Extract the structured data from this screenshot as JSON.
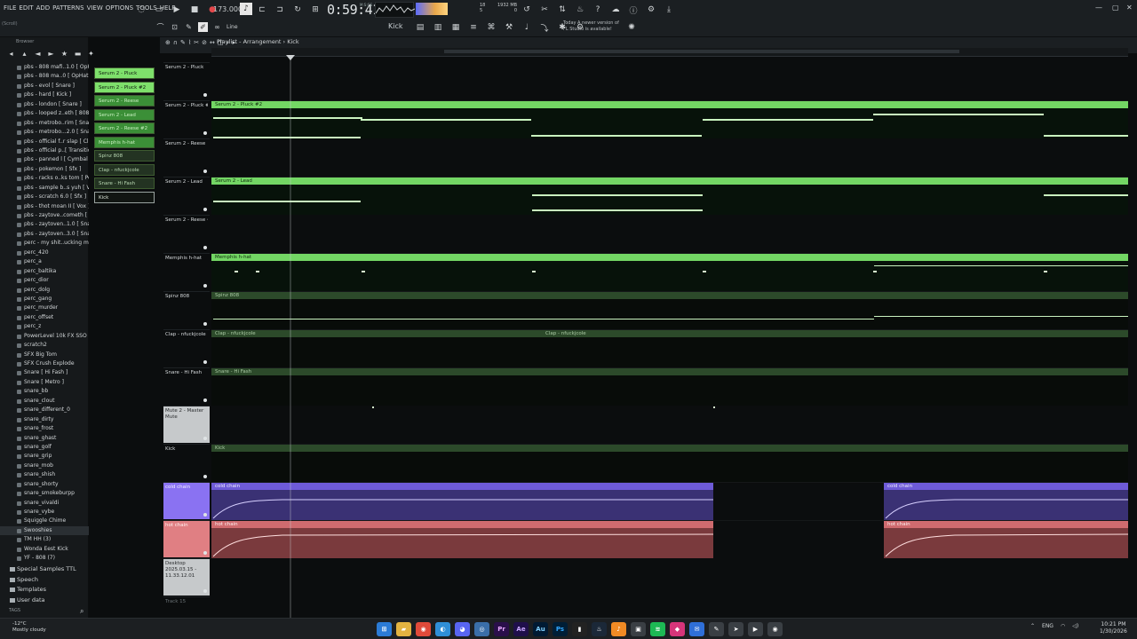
{
  "menu": [
    "FILE",
    "EDIT",
    "ADD",
    "PATTERNS",
    "VIEW",
    "OPTIONS",
    "TOOLS",
    "HELP"
  ],
  "transport": {
    "tempo": "173.000",
    "time": "0:59:41",
    "time_sub": "M:S:CS",
    "cpu": "18",
    "cpu_sub": "5",
    "mem": "1932 MB",
    "mem_sub": "0",
    "news_line1": "Today  A newer version of",
    "news_line2": "FL Studio is available!"
  },
  "toolbar": {
    "line_mode": "Line",
    "pattern": "Kick",
    "search_hint": "(Scroll)"
  },
  "browser": {
    "title": "Browser",
    "items": [
      "pbs - 808 mafi..1.0 [ OpHat ]",
      "pbs - 808 ma..0 [ OpHat ] ★",
      "pbs - evol [ Snare ]",
      "pbs - hard [ Kick ]",
      "pbs - london [ Snare ]",
      "pbs - looped z..eth [ 808 ]_2",
      "pbs - metrobo..rim [ Snare ]",
      "pbs - metrobo...2.0 [ Snare ]",
      "pbs - official f..r slap [ Clap ]",
      "pbs - official p..[ Transition]",
      "pbs - panned l [ Cymbal ]",
      "pbs - pokemon [ Sfx ]",
      "pbs - racks o..ks tom [ Perc ]",
      "pbs - sample b..s yuh [ Vox ]",
      "pbs - scratch 6.0 [ Sfx ]",
      "pbs - thot moan II [ Vox ]",
      "pbs - zaytove..cometh [ 808 ]",
      "pbs - zaytoven..1.0 [ Snare ]",
      "pbs - zaytoven..3.0 [ Snare ]",
      "perc - my shit..ucking musive",
      "perc_420",
      "perc_a",
      "perc_baltika",
      "perc_dior",
      "perc_dolg",
      "perc_gang",
      "perc_murder",
      "perc_offset",
      "perc_z",
      "PowerLevel 10k FX SSO",
      "scratch2",
      "SFX Big Tom",
      "SFX Crush Explode",
      "Snare [ Hi Fash ]",
      "Snare [ Metro ]",
      "snare_bb",
      "snare_clout",
      "snare_different_0",
      "snare_dirty",
      "snare_frost",
      "snare_ghast",
      "snare_golf",
      "snare_grip",
      "snare_mob",
      "snare_shish",
      "snare_shorty",
      "snare_smokeburpp",
      "snare_vivaldi",
      "snare_vybe",
      "Squiggle Chime",
      "Swooshies",
      "TM HH (3)",
      "Wonda Eest Kick",
      "YF - 808 (7)"
    ],
    "selected_index": 50,
    "folders": [
      "Special Samples TTL",
      "Speech",
      "Templates",
      "User data"
    ],
    "tags_label": "TAGS"
  },
  "rack": [
    {
      "label": "Serum 2 - Pluck",
      "style": "bright"
    },
    {
      "label": "Serum 2 - Pluck #2",
      "style": "bright"
    },
    {
      "label": "Serum 2 - Reese",
      "style": "mid"
    },
    {
      "label": "Serum 2 - Lead",
      "style": "mid"
    },
    {
      "label": "Serum 2 - Reese #2",
      "style": "mid"
    },
    {
      "label": "Memphis h-hat",
      "style": "mid"
    },
    {
      "label": "Spinz 808",
      "style": "dark"
    },
    {
      "label": "Clap - nfuckjcole",
      "style": "dark"
    },
    {
      "label": "Snare - Hi Fash",
      "style": "dark"
    },
    {
      "label": "Kick",
      "style": "outline"
    }
  ],
  "playlist": {
    "title": "Playlist - Arrangement › Kick",
    "tracks": [
      {
        "name": "Serum 2 - Pluck",
        "kind": "plain"
      },
      {
        "name": "Serum 2 - Pluck #2",
        "kind": "plain"
      },
      {
        "name": "Serum 2 - Reese",
        "kind": "plain"
      },
      {
        "name": "Serum 2 - Lead",
        "kind": "plain"
      },
      {
        "name": "Serum 2 - Reese #2",
        "kind": "plain"
      },
      {
        "name": "Memphis h-hat",
        "kind": "plain"
      },
      {
        "name": "Spinz 808",
        "kind": "plain"
      },
      {
        "name": "Clap - nfuckjcole",
        "kind": "plain"
      },
      {
        "name": "Snare - Hi Fash",
        "kind": "plain"
      },
      {
        "name": "Mute 2 - Master Mute",
        "kind": "gray"
      },
      {
        "name": "Kick",
        "kind": "plain"
      },
      {
        "name": "cold chain",
        "kind": "purple"
      },
      {
        "name": "hot chain",
        "kind": "pink"
      },
      {
        "name": "Desktop 2025.03.15 - 11.33.12.01",
        "kind": "desktop"
      },
      {
        "name": "Track 15",
        "kind": "empty"
      }
    ],
    "clips": [
      {
        "track": 1,
        "label": "Serum 2 - Pluck #2",
        "color": "green"
      },
      {
        "track": 3,
        "label": "Serum 2 - Lead",
        "color": "green"
      },
      {
        "track": 5,
        "label": "Memphis h-hat",
        "color": "green"
      },
      {
        "track": 6,
        "label": "Spinz 808",
        "color": "dkgreen"
      },
      {
        "track": 7,
        "label": "Clap - nfuckjcole",
        "color": "dkgreen"
      },
      {
        "track": 7,
        "label": "Clap - nfuckjcole",
        "color": "dkgreen"
      },
      {
        "track": 8,
        "label": "Snare - Hi Fash",
        "color": "dkgreen"
      },
      {
        "track": 10,
        "label": "Kick",
        "color": "dkgreen"
      },
      {
        "track": 11,
        "label": "cold chain",
        "color": "purple"
      },
      {
        "track": 11,
        "label": "cold chain",
        "color": "purple"
      },
      {
        "track": 12,
        "label": "hot chain",
        "color": "pink"
      },
      {
        "track": 12,
        "label": "hot chain",
        "color": "pink"
      }
    ]
  },
  "taskbar": {
    "weather_temp": "-12°C",
    "weather_desc": "Mostly cloudy",
    "lang": "ENG",
    "time": "10:21 PM",
    "date": "1/30/2026"
  },
  "colors": {
    "accent_green": "#73d664",
    "cold_chain": "#6e5bd8",
    "hot_chain": "#cf6b6f"
  }
}
